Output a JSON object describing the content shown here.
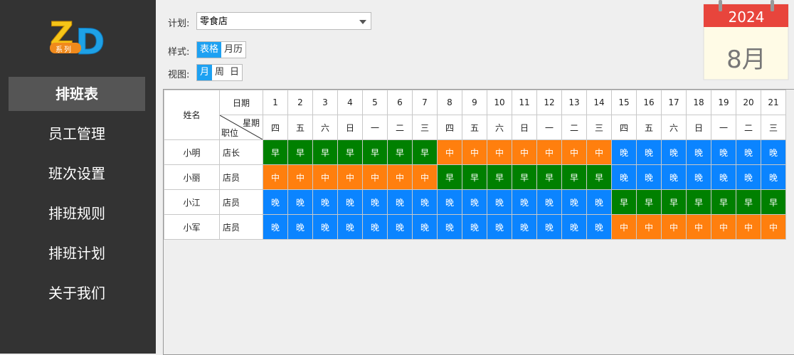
{
  "app": {
    "logo_text": "ZD",
    "logo_badge": "系列"
  },
  "sidebar": {
    "items": [
      {
        "label": "排班表",
        "active": true
      },
      {
        "label": "员工管理"
      },
      {
        "label": "班次设置"
      },
      {
        "label": "排班规则"
      },
      {
        "label": "排班计划"
      },
      {
        "label": "关于我们"
      }
    ]
  },
  "controls": {
    "plan_label": "计划:",
    "plan_value": "零食店",
    "style_label": "样式:",
    "style_options": [
      "表格",
      "月历"
    ],
    "style_selected": "表格",
    "view_label": "视图:",
    "view_options": [
      "月",
      "周",
      "日"
    ],
    "view_selected": "月"
  },
  "calendar_icon": {
    "year": "2024",
    "month": "8月"
  },
  "colors": {
    "早": "#008000",
    "中": "#ff7f0e",
    "晚": "#0b84ff",
    "accent": "#1da1f2",
    "calendar_red": "#e8453c"
  },
  "schedule": {
    "header_name": "姓名",
    "header_date": "日期",
    "header_weekday": "星期",
    "header_position": "职位",
    "dates": [
      "1",
      "2",
      "3",
      "4",
      "5",
      "6",
      "7",
      "8",
      "9",
      "10",
      "11",
      "12",
      "13",
      "14",
      "15",
      "16",
      "17",
      "18",
      "19",
      "20",
      "21"
    ],
    "weekdays": [
      "四",
      "五",
      "六",
      "日",
      "一",
      "二",
      "三",
      "四",
      "五",
      "六",
      "日",
      "一",
      "二",
      "三",
      "四",
      "五",
      "六",
      "日",
      "一",
      "二",
      "三"
    ],
    "rows": [
      {
        "name": "小明",
        "position": "店长",
        "shifts": [
          "早",
          "早",
          "早",
          "早",
          "早",
          "早",
          "早",
          "中",
          "中",
          "中",
          "中",
          "中",
          "中",
          "中",
          "晚",
          "晚",
          "晚",
          "晚",
          "晚",
          "晚",
          "晚"
        ]
      },
      {
        "name": "小丽",
        "position": "店员",
        "shifts": [
          "中",
          "中",
          "中",
          "中",
          "中",
          "中",
          "中",
          "早",
          "早",
          "早",
          "早",
          "早",
          "早",
          "早",
          "晚",
          "晚",
          "晚",
          "晚",
          "晚",
          "晚",
          "晚"
        ]
      },
      {
        "name": "小江",
        "position": "店员",
        "shifts": [
          "晚",
          "晚",
          "晚",
          "晚",
          "晚",
          "晚",
          "晚",
          "晚",
          "晚",
          "晚",
          "晚",
          "晚",
          "晚",
          "晚",
          "早",
          "早",
          "早",
          "早",
          "早",
          "早",
          "早"
        ]
      },
      {
        "name": "小军",
        "position": "店员",
        "shifts": [
          "晚",
          "晚",
          "晚",
          "晚",
          "晚",
          "晚",
          "晚",
          "晚",
          "晚",
          "晚",
          "晚",
          "晚",
          "晚",
          "晚",
          "中",
          "中",
          "中",
          "中",
          "中",
          "中",
          "中"
        ]
      }
    ]
  }
}
